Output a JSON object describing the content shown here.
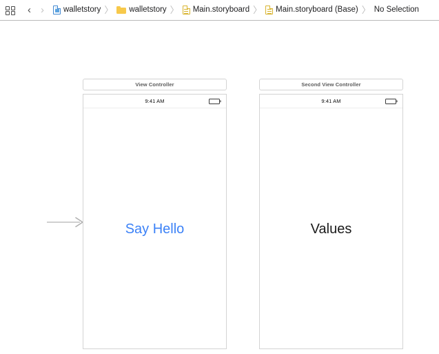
{
  "jump_bar": {
    "editor_layout_icon": "editor-layout-grid-icon",
    "back_arrow": "‹",
    "forward_arrow": "›",
    "separator": "〉",
    "breadcrumbs": [
      {
        "label": "walletstory",
        "icon": "xcode-project-document-icon",
        "icon_kind": "doc-blue"
      },
      {
        "label": "walletstory",
        "icon": "folder-icon",
        "icon_kind": "folder"
      },
      {
        "label": "Main.storyboard",
        "icon": "storyboard-document-icon",
        "icon_kind": "doc-yellow"
      },
      {
        "label": "Main.storyboard (Base)",
        "icon": "storyboard-document-icon",
        "icon_kind": "doc-yellow"
      },
      {
        "label": "No Selection",
        "icon": "",
        "icon_kind": "none"
      }
    ]
  },
  "canvas": {
    "entry_arrow_name": "initial-view-controller-arrow",
    "scenes": [
      {
        "title": "View Controller",
        "status_time": "9:41 AM",
        "battery_icon": "battery-full-icon",
        "content_label": "Say Hello",
        "content_kind": "button",
        "content_color": "#3C82F7"
      },
      {
        "title": "Second View Controller",
        "status_time": "9:41 AM",
        "battery_icon": "battery-full-icon",
        "content_label": "Values",
        "content_kind": "label",
        "content_color": "#1A1A1A"
      }
    ]
  },
  "colors": {
    "canvas_background": "#FFFFFF",
    "scene_border": "#D3D3D3",
    "toolbar_separator": "#B9B9B9",
    "ios_blue": "#3C82F7",
    "arrow_gray": "#AFAFAF"
  }
}
